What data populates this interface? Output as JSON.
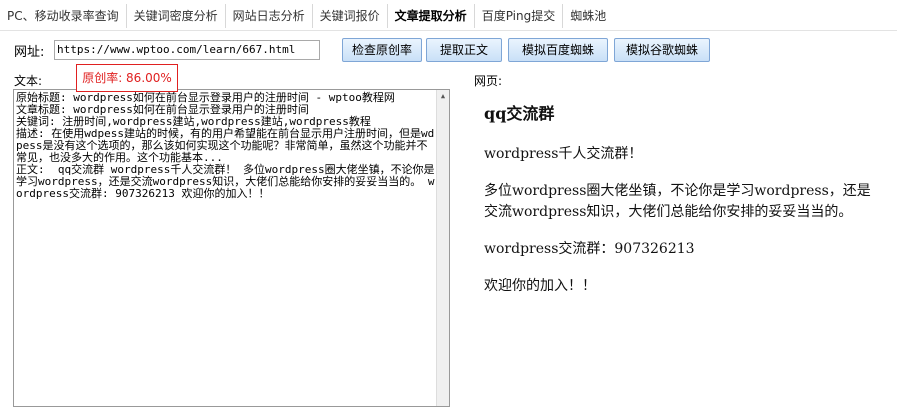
{
  "tabs": [
    {
      "label": "PC、移动收录率查询",
      "active": false
    },
    {
      "label": "关键词密度分析",
      "active": false
    },
    {
      "label": "网站日志分析",
      "active": false
    },
    {
      "label": "关键词报价",
      "active": false
    },
    {
      "label": "文章提取分析",
      "active": true
    },
    {
      "label": "百度Ping提交",
      "active": false
    },
    {
      "label": "蜘蛛池",
      "active": false
    }
  ],
  "url": {
    "label": "网址:",
    "value": "https://www.wptoo.com/learn/667.html"
  },
  "buttons": {
    "check_original": "检查原创率",
    "extract": "提取正文",
    "baidu_spider": "模拟百度蜘蛛",
    "google_spider": "模拟谷歌蜘蛛"
  },
  "text_panel": {
    "label": "文本:",
    "originality": "原创率: 86.00%",
    "lines": [
      "原始标题: wordpress如何在前台显示登录用户的注册时间 - wptoo教程网",
      "文章标题: wordpress如何在前台显示登录用户的注册时间",
      "关键词: 注册时间,wordpress建站,wordpress建站,wordpress教程",
      "描述: 在使用wdpess建站的时候，有的用户希望能在前台显示用户注册时间，但是wdpess是没有这个选项的，那么该如何实现这个功能呢？非常简单，虽然这个功能并不常见，也没多大的作用。这个功能基本...",
      "正文:  qq交流群 wordpress千人交流群！ 多位wordpress圈大佬坐镇，不论你是学习wordpress，还是交流wordpress知识，大佬们总能给你安排的妥妥当当的。 wordpress交流群: 907326213 欢迎你的加入！！"
    ]
  },
  "web_panel": {
    "label": "网页:",
    "heading": "qq交流群",
    "paragraphs": [
      "wordpress千人交流群！",
      "多位wordpress圈大佬坐镇，不论你是学习wordpress，还是交流wordpress知识，大佬们总能给你安排的妥妥当当的。",
      "wordpress交流群：907326213",
      "欢迎你的加入！！"
    ]
  }
}
